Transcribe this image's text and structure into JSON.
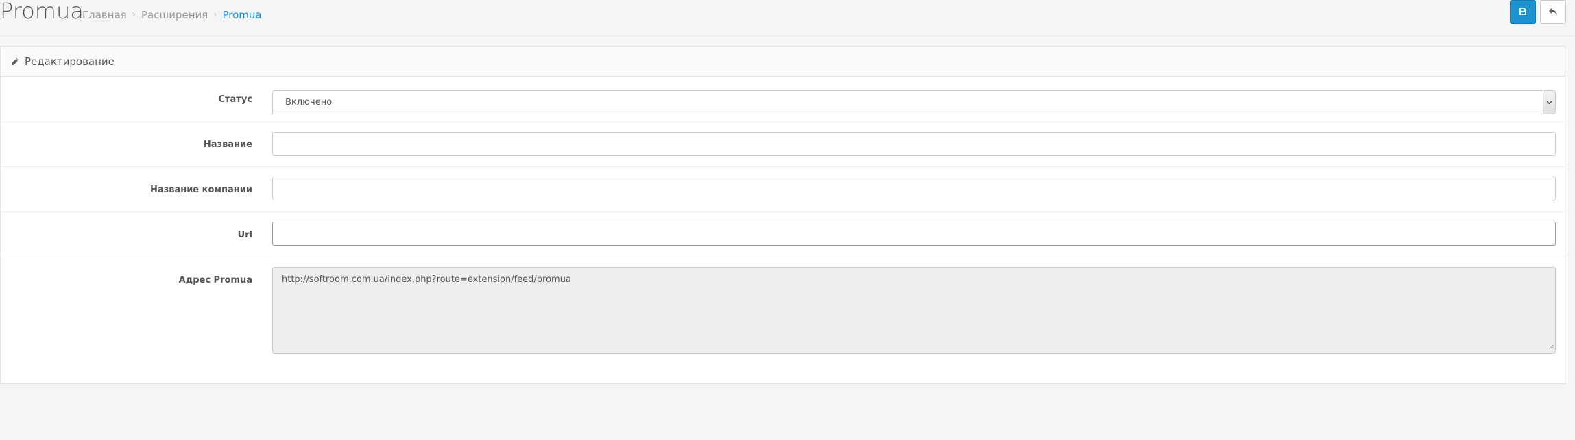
{
  "header": {
    "title": "Promua",
    "breadcrumbs": [
      {
        "label": "Главная"
      },
      {
        "label": "Расширения"
      },
      {
        "label": "Promua"
      }
    ],
    "save_icon": "save-icon",
    "back_icon": "reply-icon",
    "accent_color": "#1e91cf"
  },
  "panel": {
    "title": "Редактирование",
    "icon": "pencil-icon"
  },
  "form": {
    "status": {
      "label": "Статус",
      "value": "Включено"
    },
    "name": {
      "label": "Название",
      "value": ""
    },
    "company": {
      "label": "Название компании",
      "value": ""
    },
    "url": {
      "label": "Url",
      "value": ""
    },
    "feed": {
      "label": "Адрес Promua",
      "value": "http://softroom.com.ua/index.php?route=extension/feed/promua"
    }
  }
}
